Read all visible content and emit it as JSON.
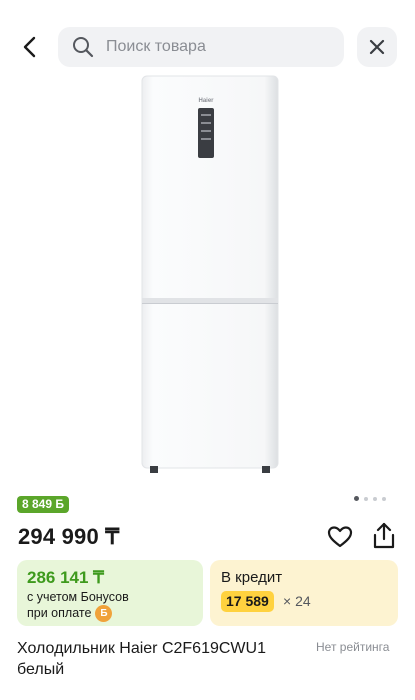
{
  "header": {
    "search_placeholder": "Поиск товара"
  },
  "product": {
    "bonus_badge": "8 849 Б",
    "price": "294 990 ₸",
    "bonus_card": {
      "price": "286 141 ₸",
      "line1": "с учетом Бонусов",
      "line2": "при оплате"
    },
    "credit_card": {
      "label": "В кредит",
      "monthly": "17 589",
      "months": "× 24"
    },
    "title": "Холодильник Haier C2F619CWU1 белый",
    "rating": "Нет рейтинга",
    "image_logo": "Haier",
    "gallery": {
      "pages": 4,
      "active": 0
    }
  },
  "colors": {
    "accent_green": "#5ba62a",
    "bonus_bg": "#e8f6d9",
    "credit_bg": "#fdf3d1",
    "credit_highlight": "#ffd23f"
  }
}
